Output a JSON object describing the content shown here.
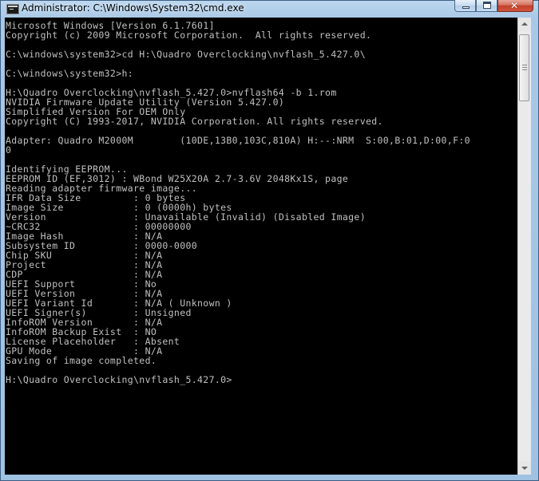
{
  "window": {
    "title": "Administrator: C:\\Windows\\System32\\cmd.exe",
    "icon": "console-icon"
  },
  "caption_buttons": {
    "minimize": "minimize-icon",
    "maximize": "maximize-icon",
    "close": "close-icon"
  },
  "console": {
    "background": "#000000",
    "foreground": "#c0c0c0",
    "lines": [
      "Microsoft Windows [Version 6.1.7601]",
      "Copyright (c) 2009 Microsoft Corporation.  All rights reserved.",
      "",
      "C:\\windows\\system32>cd H:\\Quadro Overclocking\\nvflash_5.427.0\\",
      "",
      "C:\\windows\\system32>h:",
      "",
      "H:\\Quadro Overclocking\\nvflash_5.427.0>nvflash64 -b 1.rom",
      "NVIDIA Firmware Update Utility (Version 5.427.0)",
      "Simplified Version For OEM Only",
      "Copyright (C) 1993-2017, NVIDIA Corporation. All rights reserved.",
      "",
      "Adapter: Quadro M2000M        (10DE,13B0,103C,810A) H:--:NRM  S:00,B:01,D:00,F:0",
      "0",
      "",
      "Identifying EEPROM...",
      "EEPROM ID (EF,3012) : WBond W25X20A 2.7-3.6V 2048Kx1S, page",
      "Reading adapter firmware image...",
      "IFR Data Size         : 0 bytes",
      "Image Size            : 0 (0000h) bytes",
      "Version               : Unavailable (Invalid) (Disabled Image)",
      "~CRC32                : 00000000",
      "Image Hash            : N/A",
      "Subsystem ID          : 0000-0000",
      "Chip SKU              : N/A",
      "Project               : N/A",
      "CDP                   : N/A",
      "UEFI Support          : No",
      "UEFI Version          : N/A",
      "UEFI Variant Id       : N/A ( Unknown )",
      "UEFI Signer(s)        : Unsigned",
      "InfoROM Version       : N/A",
      "InfoROM Backup Exist  : NO",
      "License Placeholder   : Absent",
      "GPU Mode              : N/A",
      "Saving of image completed.",
      "",
      "H:\\Quadro Overclocking\\nvflash_5.427.0>"
    ]
  },
  "scrollbar": {
    "up_arrow": "scroll-up-arrow-icon",
    "down_arrow": "scroll-down-arrow-icon"
  }
}
